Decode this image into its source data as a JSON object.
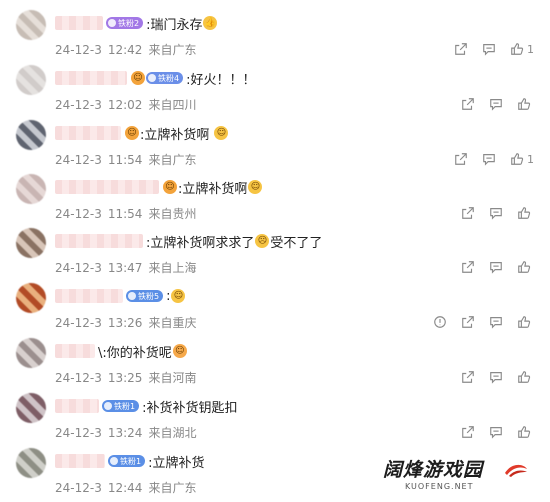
{
  "comments": [
    {
      "badge": "铁粉2",
      "badge_color": "#a278e6",
      "text": ":瑞门永存",
      "emoji_after": "👍",
      "date": "24-12-3",
      "time": "12:42",
      "location": "来自广东",
      "likes": "1"
    },
    {
      "badge": "铁粉4",
      "badge_color": "#6b8fe8",
      "text": ":好火！！！",
      "emoji_after": "",
      "date": "24-12-3",
      "time": "12:02",
      "location": "来自四川",
      "likes": ""
    },
    {
      "badge": "",
      "badge_color": "",
      "text": ":立牌补货啊",
      "emoji_after": "😬",
      "date": "24-12-3",
      "time": "11:54",
      "location": "来自广东",
      "likes": "1"
    },
    {
      "badge": "",
      "badge_color": "",
      "text": ":立牌补货啊",
      "emoji_after": "😀",
      "date": "24-12-3",
      "time": "11:54",
      "location": "来自贵州",
      "likes": ""
    },
    {
      "badge": "",
      "badge_color": "",
      "text": ":立牌补货啊求求了",
      "emoji_after": "😭",
      "text_after": "受不了了",
      "date": "24-12-3",
      "time": "13:47",
      "location": "来自上海",
      "likes": ""
    },
    {
      "badge": "铁粉5",
      "badge_color": "#5b8fe6",
      "text": ":",
      "emoji_after": "😊",
      "date": "24-12-3",
      "time": "13:26",
      "location": "来自重庆",
      "likes": ""
    },
    {
      "badge": "",
      "badge_color": "",
      "text": "\\:你的补货呢",
      "emoji_after": "😮",
      "date": "24-12-3",
      "time": "13:25",
      "location": "来自河南",
      "likes": ""
    },
    {
      "badge": "铁粉1",
      "badge_color": "#5b8fe6",
      "text": ":补货补货钥匙扣",
      "emoji_after": "",
      "date": "24-12-3",
      "time": "13:24",
      "location": "来自湖北",
      "likes": ""
    },
    {
      "badge": "铁粉1",
      "badge_color": "#5b8fe6",
      "text": ":立牌补货",
      "emoji_after": "",
      "date": "24-12-3",
      "time": "12:44",
      "location": "来自广东",
      "likes": ""
    }
  ],
  "watermark": {
    "title": "阔烽游戏园",
    "subtitle": "KUOFENG.NET"
  }
}
